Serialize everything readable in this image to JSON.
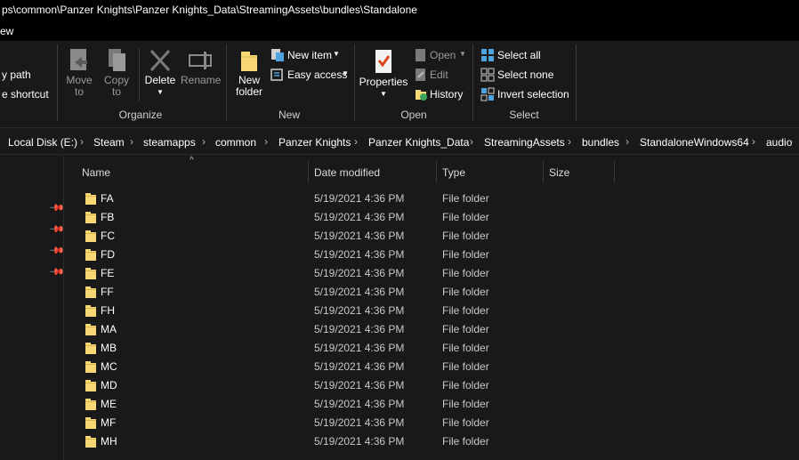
{
  "window": {
    "title": "ps\\common\\Panzer Knights\\Panzer Knights_Data\\StreamingAssets\\bundles\\Standalone"
  },
  "menu": {
    "tab_partial": "ew"
  },
  "ribbon": {
    "clipboard": {
      "copy_path": "y path",
      "paste_shortcut": "e shortcut"
    },
    "organize": {
      "label": "Organize",
      "move_to": [
        "Move",
        "to"
      ],
      "copy_to": [
        "Copy",
        "to"
      ],
      "delete": "Delete",
      "rename": "Rename"
    },
    "new": {
      "label": "New",
      "new_folder": [
        "New",
        "folder"
      ],
      "new_item": "New item",
      "easy_access": "Easy access"
    },
    "open": {
      "label": "Open",
      "properties": "Properties",
      "open": "Open",
      "edit": "Edit",
      "history": "History"
    },
    "select": {
      "label": "Select",
      "select_all": "Select all",
      "select_none": "Select none",
      "invert_selection": "Invert selection"
    }
  },
  "address": {
    "crumbs": [
      "Local Disk (E:)",
      "Steam",
      "steamapps",
      "common",
      "Panzer Knights",
      "Panzer Knights_Data",
      "StreamingAssets",
      "bundles",
      "StandaloneWindows64",
      "audio"
    ]
  },
  "columns": {
    "name": "Name",
    "date_modified": "Date modified",
    "type": "Type",
    "size": "Size"
  },
  "files": [
    {
      "name": "FA",
      "date": "5/19/2021 4:36 PM",
      "type": "File folder"
    },
    {
      "name": "FB",
      "date": "5/19/2021 4:36 PM",
      "type": "File folder"
    },
    {
      "name": "FC",
      "date": "5/19/2021 4:36 PM",
      "type": "File folder"
    },
    {
      "name": "FD",
      "date": "5/19/2021 4:36 PM",
      "type": "File folder"
    },
    {
      "name": "FE",
      "date": "5/19/2021 4:36 PM",
      "type": "File folder"
    },
    {
      "name": "FF",
      "date": "5/19/2021 4:36 PM",
      "type": "File folder"
    },
    {
      "name": "FH",
      "date": "5/19/2021 4:36 PM",
      "type": "File folder"
    },
    {
      "name": "MA",
      "date": "5/19/2021 4:36 PM",
      "type": "File folder"
    },
    {
      "name": "MB",
      "date": "5/19/2021 4:36 PM",
      "type": "File folder"
    },
    {
      "name": "MC",
      "date": "5/19/2021 4:36 PM",
      "type": "File folder"
    },
    {
      "name": "MD",
      "date": "5/19/2021 4:36 PM",
      "type": "File folder"
    },
    {
      "name": "ME",
      "date": "5/19/2021 4:36 PM",
      "type": "File folder"
    },
    {
      "name": "MF",
      "date": "5/19/2021 4:36 PM",
      "type": "File folder"
    },
    {
      "name": "MH",
      "date": "5/19/2021 4:36 PM",
      "type": "File folder"
    }
  ],
  "colors": {
    "background": "#191919",
    "titlebar": "#000000",
    "folder": "#f8d775",
    "accent_check": "#d9471d",
    "select_icon": "#4fa3e0"
  }
}
